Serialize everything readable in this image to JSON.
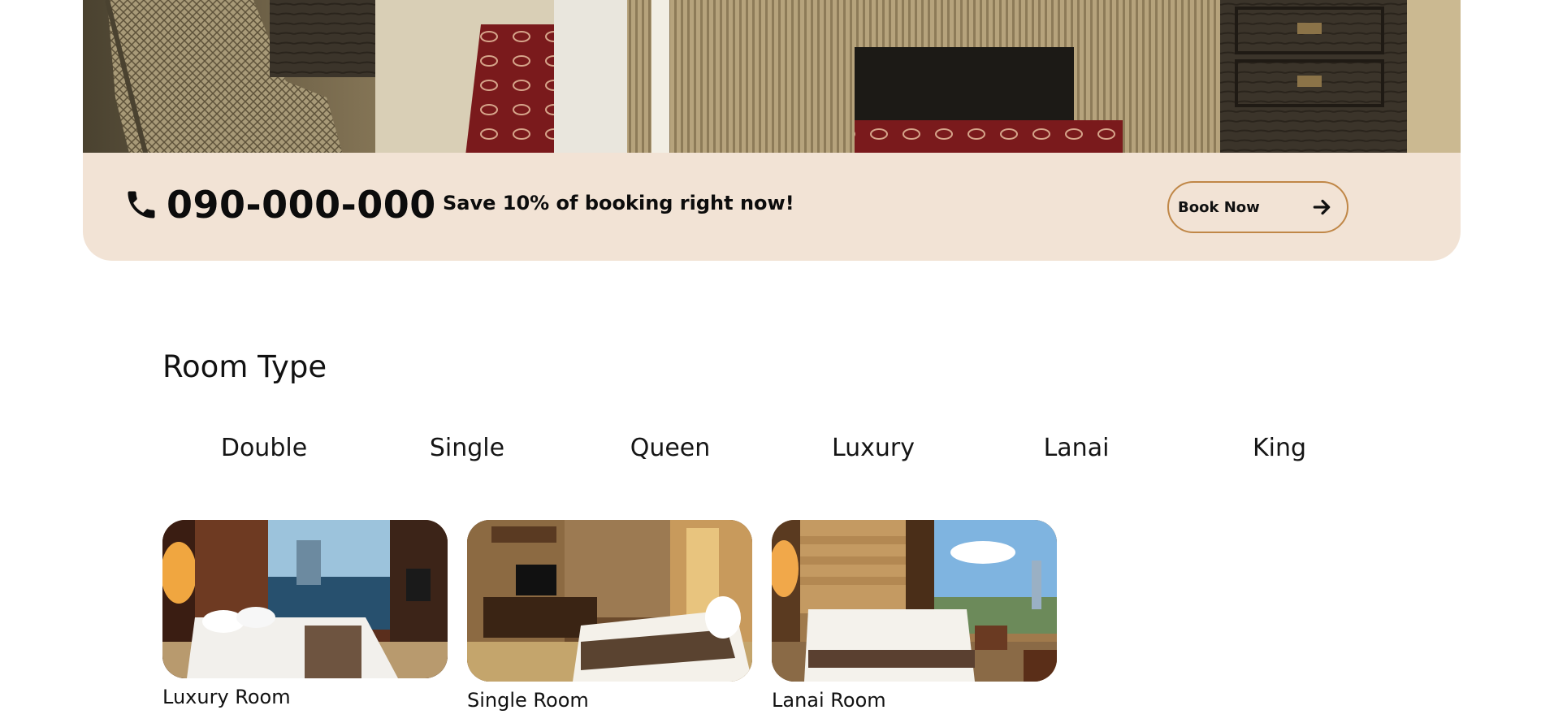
{
  "hero": {
    "image_icon": "hotel-room-photo"
  },
  "promo": {
    "phone_icon": "phone-icon",
    "phone_number": "090-000-000",
    "offer_text": "Save 10% of booking right now!",
    "book_button_label": "Book Now",
    "book_button_icon": "arrow-right-icon",
    "colors": {
      "background": "#f2e3d5",
      "button_border": "#c08747"
    }
  },
  "room_types": {
    "title": "Room Type",
    "tabs": [
      {
        "label": "Double"
      },
      {
        "label": "Single"
      },
      {
        "label": "Queen"
      },
      {
        "label": "Luxury"
      },
      {
        "label": "Lanai"
      },
      {
        "label": "King"
      }
    ],
    "rooms": [
      {
        "name": "Luxury Room",
        "image_icon": "luxury-room-photo"
      },
      {
        "name": "Single Room",
        "image_icon": "single-room-photo"
      },
      {
        "name": "Lanai Room",
        "image_icon": "lanai-room-photo"
      }
    ]
  }
}
